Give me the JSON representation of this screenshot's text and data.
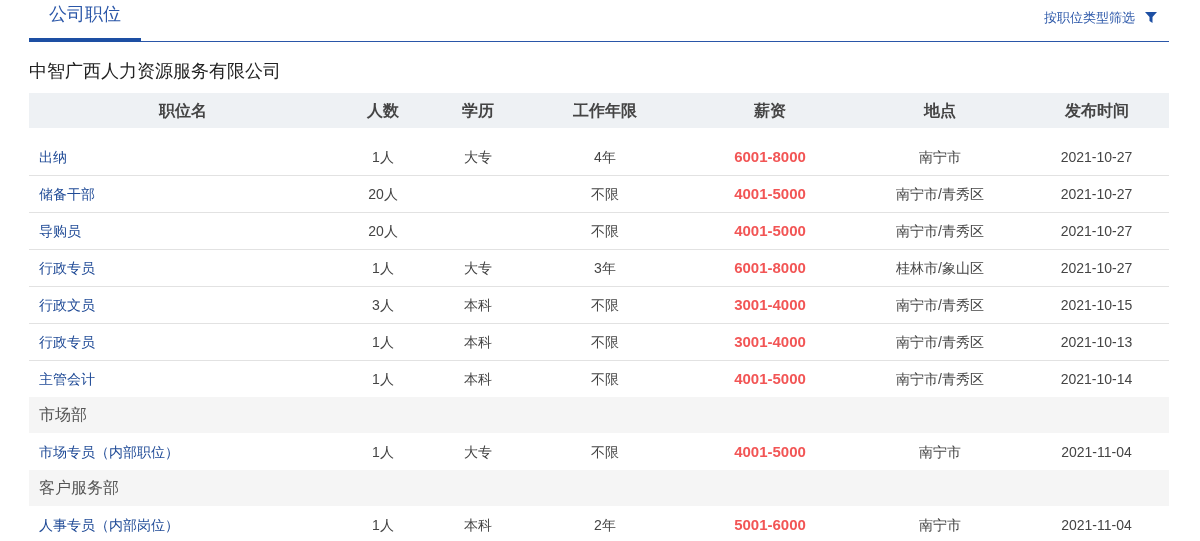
{
  "tabs": [
    {
      "label": "公司职位",
      "selected": true
    }
  ],
  "filter": {
    "label": "按职位类型筛选"
  },
  "company": "中智广西人力资源服务有限公司",
  "table": {
    "columns": [
      "职位名",
      "人数",
      "学历",
      "工作年限",
      "薪资",
      "地点",
      "发布时间"
    ],
    "rows": [
      {
        "kind": "job",
        "cells": [
          "出纳",
          "1人",
          "大专",
          "4年",
          "6001-8000",
          "南宁市",
          "2021-10-27"
        ]
      },
      {
        "kind": "job",
        "cells": [
          "储备干部",
          "20人",
          "",
          "不限",
          "4001-5000",
          "南宁市/青秀区",
          "2021-10-27"
        ]
      },
      {
        "kind": "job",
        "cells": [
          "导购员",
          "20人",
          "",
          "不限",
          "4001-5000",
          "南宁市/青秀区",
          "2021-10-27"
        ]
      },
      {
        "kind": "job",
        "cells": [
          "行政专员",
          "1人",
          "大专",
          "3年",
          "6001-8000",
          "桂林市/象山区",
          "2021-10-27"
        ]
      },
      {
        "kind": "job",
        "cells": [
          "行政文员",
          "3人",
          "本科",
          "不限",
          "3001-4000",
          "南宁市/青秀区",
          "2021-10-15"
        ]
      },
      {
        "kind": "job",
        "cells": [
          "行政专员",
          "1人",
          "本科",
          "不限",
          "3001-4000",
          "南宁市/青秀区",
          "2021-10-13"
        ]
      },
      {
        "kind": "job",
        "cells": [
          "主管会计",
          "1人",
          "本科",
          "不限",
          "4001-5000",
          "南宁市/青秀区",
          "2021-10-14"
        ]
      },
      {
        "kind": "group",
        "title": "市场部"
      },
      {
        "kind": "job",
        "cells": [
          "市场专员（内部职位）",
          "1人",
          "大专",
          "不限",
          "4001-5000",
          "南宁市",
          "2021-11-04"
        ]
      },
      {
        "kind": "group",
        "title": "客户服务部"
      },
      {
        "kind": "job",
        "cells": [
          "人事专员（内部岗位）",
          "1人",
          "本科",
          "2年",
          "5001-6000",
          "南宁市",
          "2021-11-04"
        ]
      }
    ]
  }
}
